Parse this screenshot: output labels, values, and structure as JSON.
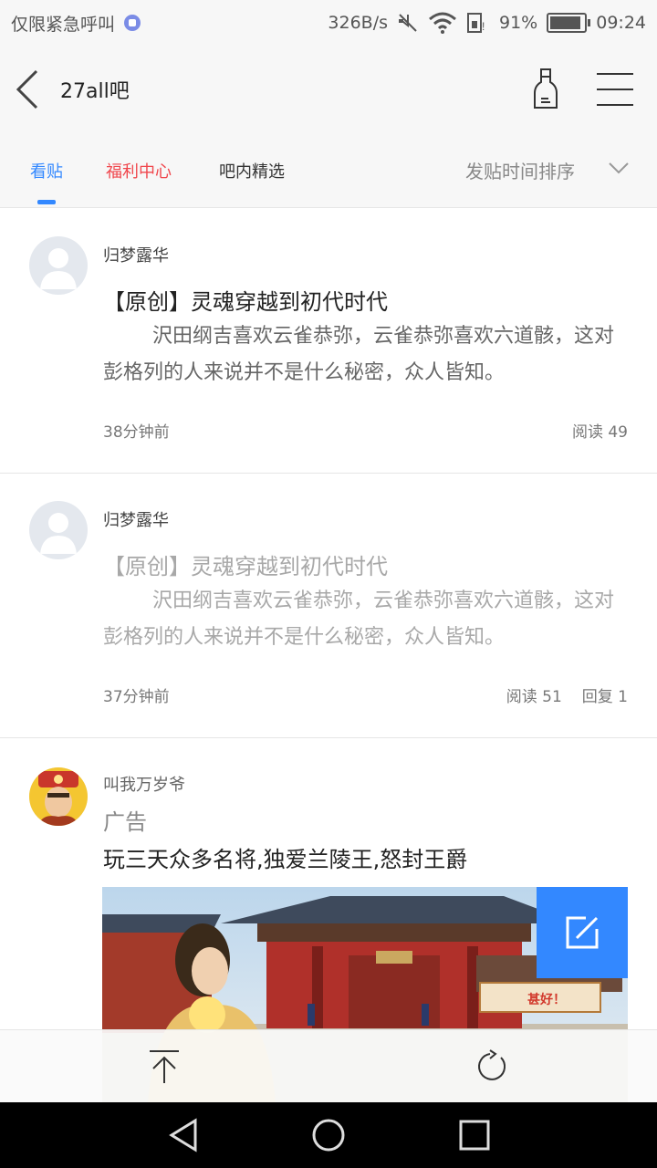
{
  "status_bar": {
    "left_text": "仅限紧急呼叫",
    "net_speed": "326B/s",
    "battery_percent": "91%",
    "time": "09:24",
    "battery_level": 0.91
  },
  "header": {
    "title": "27all吧"
  },
  "tabs": [
    {
      "label": "看贴"
    },
    {
      "label": "福利中心"
    },
    {
      "label": "吧内精选"
    }
  ],
  "sort": {
    "label": "发贴时间排序"
  },
  "posts": [
    {
      "author": "归梦露华",
      "title": "【原创】灵魂穿越到初代时代",
      "body": "沢田纲吉喜欢云雀恭弥，云雀恭弥喜欢六道骸，这对彭格列的人来说并不是什么秘密，众人皆知。",
      "time": "38分钟前",
      "read_label": "阅读",
      "read_count": "49"
    },
    {
      "author": "归梦露华",
      "title": "【原创】灵魂穿越到初代时代",
      "body": "沢田纲吉喜欢云雀恭弥，云雀恭弥喜欢六道骸，这对彭格列的人来说并不是什么秘密，众人皆知。",
      "time": "37分钟前",
      "read_label": "阅读",
      "read_count": "51",
      "reply_label": "回复",
      "reply_count": "1"
    }
  ],
  "ad": {
    "author": "叫我万岁爷",
    "tag": "广告",
    "title": "玩三天众多名将,独爱兰陵王,怒封王爵",
    "banner_button": "甚好！"
  },
  "colors": {
    "accent": "#3388ff",
    "welfare": "#f0464c"
  }
}
